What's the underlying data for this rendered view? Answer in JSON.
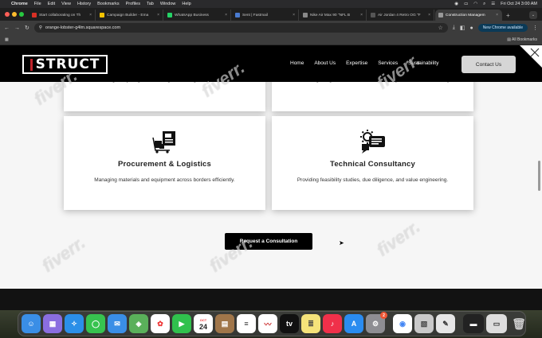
{
  "menubar": {
    "app": "Chrome",
    "menus": [
      "File",
      "Edit",
      "View",
      "History",
      "Bookmarks",
      "Profiles",
      "Tab",
      "Window",
      "Help"
    ],
    "datetime": "Fri Oct 24  3:00 AM"
  },
  "tabs": [
    {
      "label": "Start collaborating on Th",
      "color": "#d93025"
    },
    {
      "label": "Campaign Builder - Ema",
      "color": "#f2c200"
    },
    {
      "label": "WhatsApp Business",
      "color": "#25d366"
    },
    {
      "label": "Sent | Fastmail",
      "color": "#4a7bd0"
    },
    {
      "label": "Nike Air Max 90 \"NFL B",
      "color": "#888888"
    },
    {
      "label": "Air Jordan 4 Retro OG \"F",
      "color": "#555555"
    },
    {
      "label": "Construction Managem",
      "color": "#999999",
      "active": true
    }
  ],
  "toolbar": {
    "url": "orange-lobster-g4lm.squarespace.com",
    "new_chrome": "New Chrome available",
    "all_bookmarks": "All Bookmarks"
  },
  "site": {
    "logo": "STRUCT",
    "nav": [
      "Home",
      "About Us",
      "Expertise",
      "Services",
      "Sustainability"
    ],
    "contact": "Contact Us",
    "top_left_text": "Overseeing every stage, from design tendering to site supervision.",
    "top_right_text": "Controlling budgets, costs and to ensure projects to deliver certainty.",
    "cards": [
      {
        "title": "Procurement & Logistics",
        "desc": "Managing materials and equipment across borders efficiently.",
        "icon": "logistics-icon"
      },
      {
        "title": "Technical Consultancy",
        "desc": "Providing feasibility studies, due diligence, and value engineering.",
        "icon": "consultancy-icon"
      }
    ],
    "cta": "Request a Consultation"
  },
  "watermark": "fiverr.",
  "dock": {
    "calendar_month": "OCT",
    "calendar_day": "24",
    "settings_badge": "2"
  }
}
